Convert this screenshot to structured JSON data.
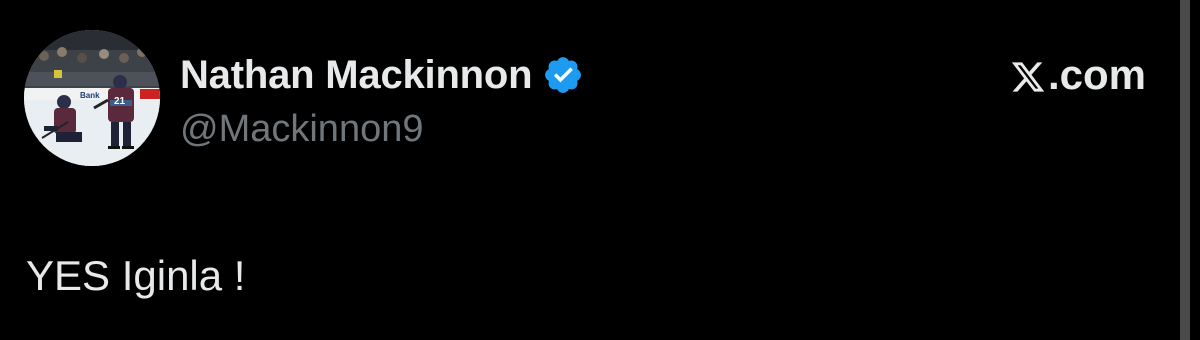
{
  "tweet": {
    "display_name": "Nathan Mackinnon",
    "handle": "@Mackinnon9",
    "verified": true,
    "text": "YES Iginla !",
    "source_suffix": ".com",
    "source_logo": "x-logo-icon",
    "avatar_icon": "hockey-players-photo",
    "avatar_jersey_number": "21",
    "avatar_ad_text": "Bank"
  },
  "colors": {
    "background": "#000000",
    "text_primary": "#e7e9ea",
    "text_secondary": "#71767b",
    "verified_blue": "#1d9bf0"
  }
}
